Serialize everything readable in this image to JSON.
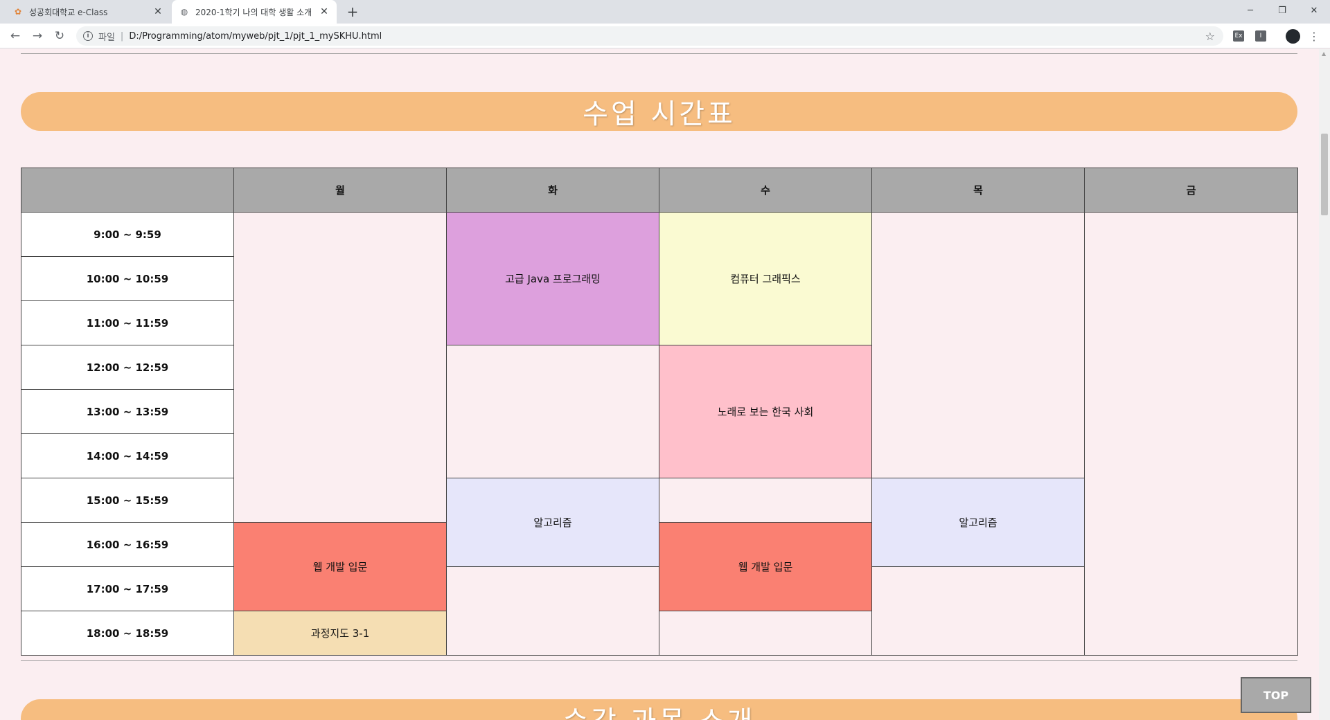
{
  "browser": {
    "tabs": [
      {
        "title": "성공회대학교 e-Class",
        "active": false
      },
      {
        "title": "2020-1학기 나의 대학 생활 소개",
        "active": true
      }
    ],
    "address": {
      "scheme_label": "파일",
      "url": "D:/Programming/atom/myweb/pjt_1/pjt_1_mySKHU.html"
    },
    "extensions": [
      "Ex",
      "I"
    ]
  },
  "page": {
    "timetable_title": "수업 시간표",
    "next_section_title": "수강 과목 소개",
    "top_button": "TOP"
  },
  "timetable": {
    "days": [
      "월",
      "화",
      "수",
      "목",
      "금"
    ],
    "times": [
      "9:00 ~ 9:59",
      "10:00 ~ 10:59",
      "11:00 ~ 11:59",
      "12:00 ~ 12:59",
      "13:00 ~ 13:59",
      "14:00 ~ 14:59",
      "15:00 ~ 15:59",
      "16:00 ~ 16:59",
      "17:00 ~ 17:59",
      "18:00 ~ 18:59"
    ],
    "classes": {
      "java": "고급 Java 프로그래밍",
      "graphics": "컴퓨터 그래픽스",
      "korean_society": "노래로 보는 한국 사회",
      "algorithm_tue": "알고리즘",
      "algorithm_thu": "알고리즘",
      "web_mon": "웹 개발 입문",
      "web_wed": "웹 개발 입문",
      "advising": "과정지도 3-1"
    },
    "colors": {
      "header": "#a9a9a9",
      "java": "#dda0dd",
      "graphics": "#fafad2",
      "korean_society": "#ffc0cb",
      "algorithm": "#e6e6fa",
      "web": "#fa8072",
      "advising": "#f5deb3"
    }
  }
}
